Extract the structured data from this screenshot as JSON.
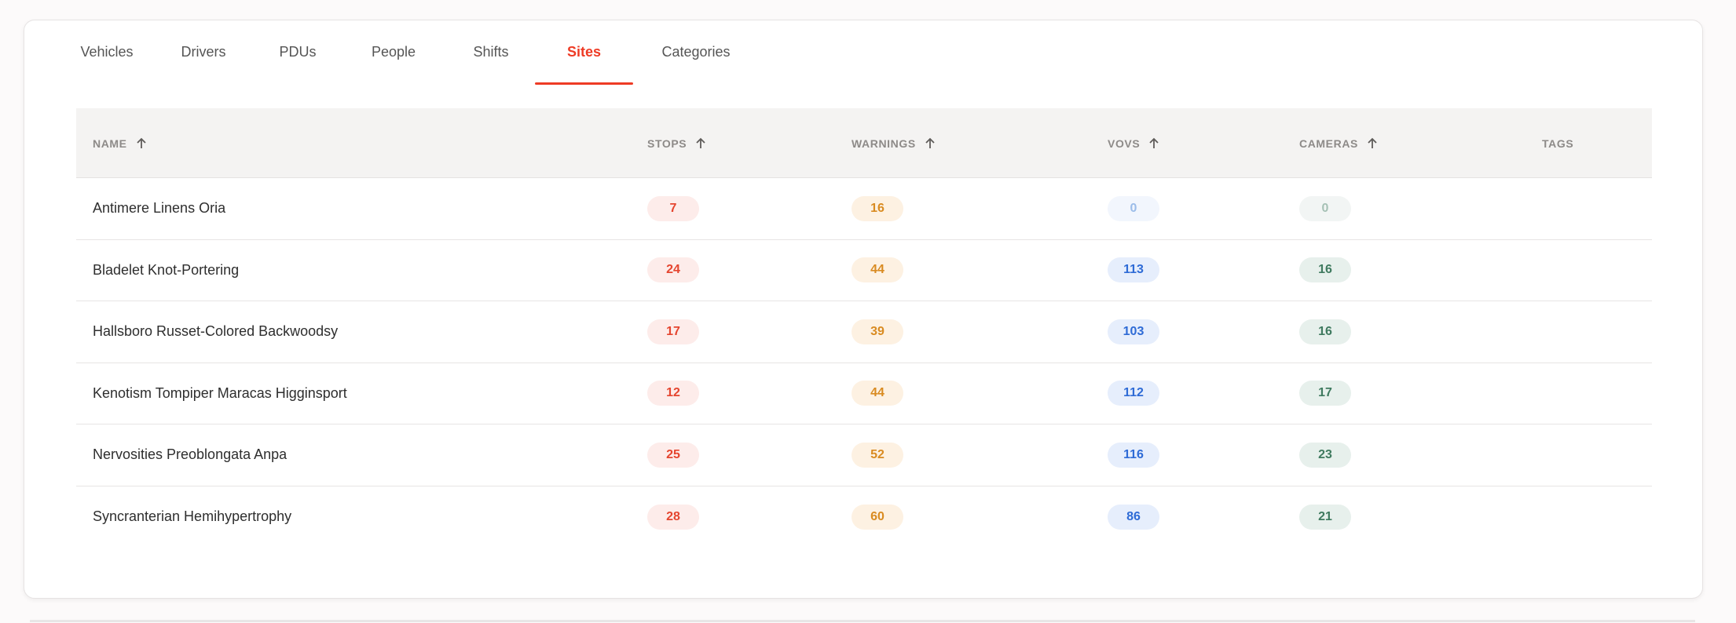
{
  "tabs": [
    {
      "label": "Vehicles",
      "active": false
    },
    {
      "label": "Drivers",
      "active": false
    },
    {
      "label": "PDUs",
      "active": false
    },
    {
      "label": "People",
      "active": false
    },
    {
      "label": "Shifts",
      "active": false
    },
    {
      "label": "Sites",
      "active": true
    },
    {
      "label": "Categories",
      "active": false
    }
  ],
  "table": {
    "columns": [
      {
        "label": "NAME",
        "sortable": true
      },
      {
        "label": "STOPS",
        "sortable": true
      },
      {
        "label": "WARNINGS",
        "sortable": true
      },
      {
        "label": "VOVS",
        "sortable": true
      },
      {
        "label": "CAMERAS",
        "sortable": true
      },
      {
        "label": "TAGS",
        "sortable": false
      }
    ],
    "rows": [
      {
        "name": "Antimere Linens Oria",
        "stops": "7",
        "warnings": "16",
        "vovs": "0",
        "cameras": "0"
      },
      {
        "name": "Bladelet Knot-Portering",
        "stops": "24",
        "warnings": "44",
        "vovs": "113",
        "cameras": "16"
      },
      {
        "name": "Hallsboro Russet-Colored Backwoodsy",
        "stops": "17",
        "warnings": "39",
        "vovs": "103",
        "cameras": "16"
      },
      {
        "name": "Kenotism Tompiper Maracas Higginsport",
        "stops": "12",
        "warnings": "44",
        "vovs": "112",
        "cameras": "17"
      },
      {
        "name": "Nervosities Preoblongata Anpa",
        "stops": "25",
        "warnings": "52",
        "vovs": "116",
        "cameras": "23"
      },
      {
        "name": "Syncranterian Hemihypertrophy",
        "stops": "28",
        "warnings": "60",
        "vovs": "86",
        "cameras": "21"
      }
    ]
  },
  "icons": {
    "sort": "arrow-up-icon"
  },
  "colors": {
    "accent": "#ee3b25",
    "stops": "#e5452f",
    "warnings": "#d98b21",
    "vovs": "#2e6bd6",
    "cameras": "#3f7a5f"
  }
}
